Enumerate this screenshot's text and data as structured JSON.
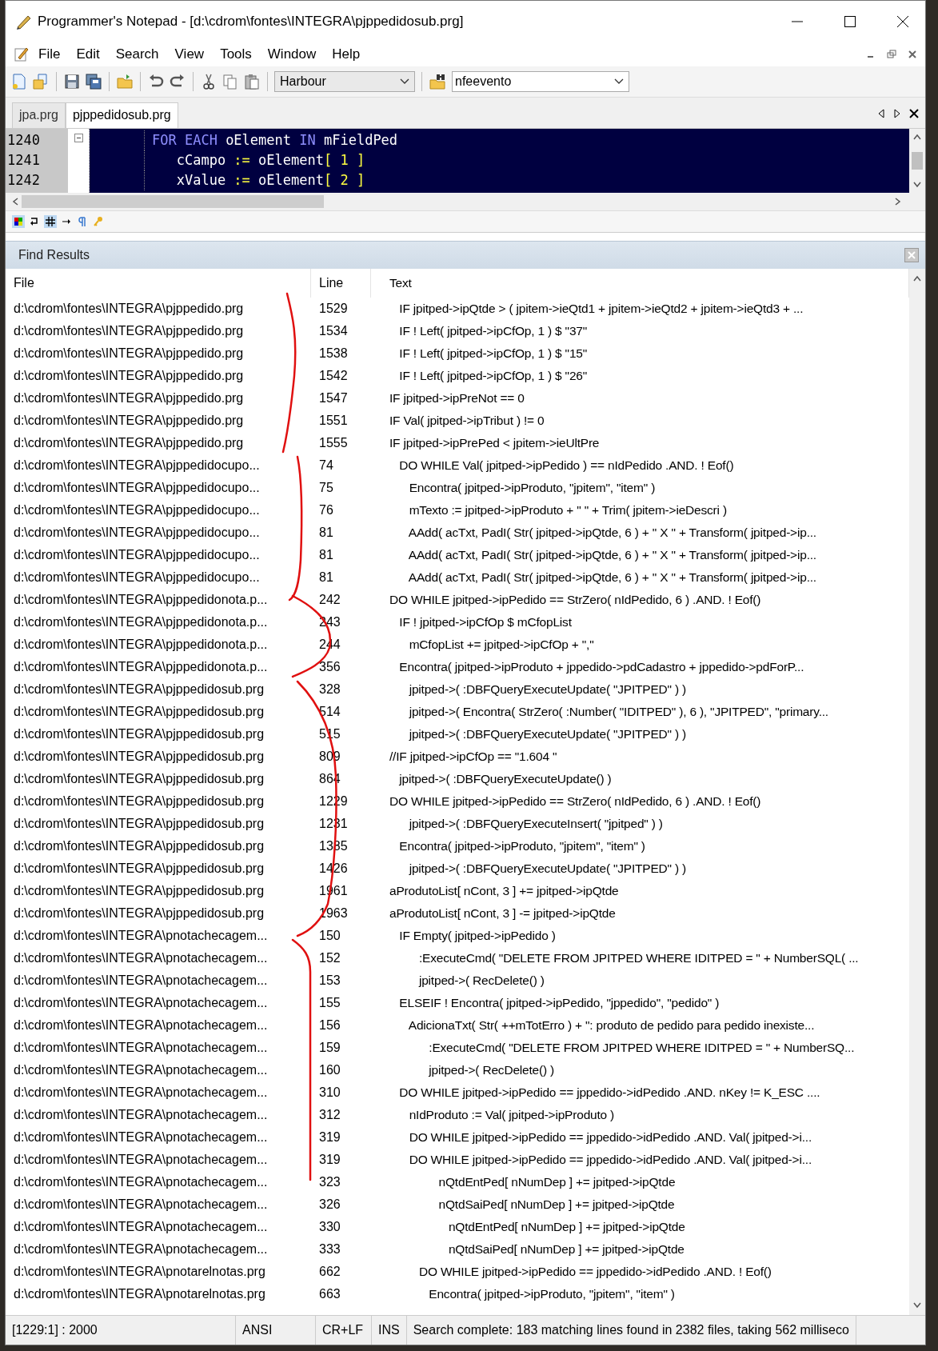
{
  "window": {
    "title": "Programmer's Notepad - [d:\\cdrom\\fontes\\INTEGRA\\pjppedidosub.prg]"
  },
  "menu": [
    "File",
    "Edit",
    "Search",
    "View",
    "Tools",
    "Window",
    "Help"
  ],
  "toolbar": {
    "language": "Harbour",
    "find": "nfeevento"
  },
  "tabs": [
    {
      "label": "jpa.prg",
      "selected": false
    },
    {
      "label": "pjppedidosub.prg",
      "selected": true
    }
  ],
  "editor": {
    "lines": [
      {
        "number": "1240",
        "tokens": [
          {
            "text": "FOR EACH",
            "kind": "keyword"
          },
          {
            "text": " oElement ",
            "kind": "ident"
          },
          {
            "text": "IN",
            "kind": "keyword"
          },
          {
            "text": " mFieldPed",
            "kind": "ident"
          }
        ]
      },
      {
        "number": "1241",
        "tokens": [
          {
            "text": "   cCampo ",
            "kind": "ident"
          },
          {
            "text": ":=",
            "kind": "op"
          },
          {
            "text": " oElement",
            "kind": "ident"
          },
          {
            "text": "[ 1 ]",
            "kind": "op"
          }
        ]
      },
      {
        "number": "1242",
        "tokens": [
          {
            "text": "   xValue ",
            "kind": "ident"
          },
          {
            "text": ":=",
            "kind": "op"
          },
          {
            "text": " oElement",
            "kind": "ident"
          },
          {
            "text": "[ 2 ]",
            "kind": "op"
          }
        ]
      }
    ]
  },
  "find_results": {
    "title": "Find Results",
    "columns": [
      "File",
      "Line",
      "Text"
    ],
    "rows": [
      {
        "file": "d:\\cdrom\\fontes\\INTEGRA\\pjppedido.prg",
        "line": "1529",
        "text": "   IF jpitped->ipQtde > ( jpitem->ieQtd1 + jpitem->ieQtd2 + jpitem->ieQtd3 + ..."
      },
      {
        "file": "d:\\cdrom\\fontes\\INTEGRA\\pjppedido.prg",
        "line": "1534",
        "text": "   IF ! Left( jpitped->ipCfOp, 1 ) $ \"37\""
      },
      {
        "file": "d:\\cdrom\\fontes\\INTEGRA\\pjppedido.prg",
        "line": "1538",
        "text": "   IF ! Left( jpitped->ipCfOp, 1 ) $ \"15\""
      },
      {
        "file": "d:\\cdrom\\fontes\\INTEGRA\\pjppedido.prg",
        "line": "1542",
        "text": "   IF ! Left( jpitped->ipCfOp, 1 ) $ \"26\""
      },
      {
        "file": "d:\\cdrom\\fontes\\INTEGRA\\pjppedido.prg",
        "line": "1547",
        "text": "IF jpitped->ipPreNot == 0"
      },
      {
        "file": "d:\\cdrom\\fontes\\INTEGRA\\pjppedido.prg",
        "line": "1551",
        "text": "IF Val( jpitped->ipTribut ) != 0"
      },
      {
        "file": "d:\\cdrom\\fontes\\INTEGRA\\pjppedido.prg",
        "line": "1555",
        "text": "IF jpitped->ipPrePed < jpitem->ieUltPre"
      },
      {
        "file": "d:\\cdrom\\fontes\\INTEGRA\\pjppedidocupo...",
        "line": "74",
        "text": "   DO WHILE Val( jpitped->ipPedido ) == nIdPedido .AND. ! Eof()"
      },
      {
        "file": "d:\\cdrom\\fontes\\INTEGRA\\pjppedidocupo...",
        "line": "75",
        "text": "      Encontra( jpitped->ipProduto, \"jpitem\", \"item\" )"
      },
      {
        "file": "d:\\cdrom\\fontes\\INTEGRA\\pjppedidocupo...",
        "line": "76",
        "text": "      mTexto := jpitped->ipProduto + \" \" + Trim( jpitem->ieDescri )"
      },
      {
        "file": "d:\\cdrom\\fontes\\INTEGRA\\pjppedidocupo...",
        "line": "81",
        "text": "      AAdd( acTxt, PadI( Str( jpitped->ipQtde, 6 ) + \" X \" + Transform( jpitped->ip..."
      },
      {
        "file": "d:\\cdrom\\fontes\\INTEGRA\\pjppedidocupo...",
        "line": "81",
        "text": "      AAdd( acTxt, PadI( Str( jpitped->ipQtde, 6 ) + \" X \" + Transform( jpitped->ip..."
      },
      {
        "file": "d:\\cdrom\\fontes\\INTEGRA\\pjppedidocupo...",
        "line": "81",
        "text": "      AAdd( acTxt, PadI( Str( jpitped->ipQtde, 6 ) + \" X \" + Transform( jpitped->ip..."
      },
      {
        "file": "d:\\cdrom\\fontes\\INTEGRA\\pjppedidonota.p...",
        "line": "242",
        "text": "DO WHILE jpitped->ipPedido == StrZero( nIdPedido, 6 ) .AND. ! Eof()"
      },
      {
        "file": "d:\\cdrom\\fontes\\INTEGRA\\pjppedidonota.p...",
        "line": "243",
        "text": "   IF ! jpitped->ipCfOp $ mCfopList"
      },
      {
        "file": "d:\\cdrom\\fontes\\INTEGRA\\pjppedidonota.p...",
        "line": "244",
        "text": "      mCfopList += jpitped->ipCfOp + \",\""
      },
      {
        "file": "d:\\cdrom\\fontes\\INTEGRA\\pjppedidonota.p...",
        "line": "356",
        "text": "   Encontra( jpitped->ipProduto + jppedido->pdCadastro + jppedido->pdForP..."
      },
      {
        "file": "d:\\cdrom\\fontes\\INTEGRA\\pjppedidosub.prg",
        "line": "328",
        "text": "      jpitped->( :DBFQueryExecuteUpdate( \"JPITPED\" ) )"
      },
      {
        "file": "d:\\cdrom\\fontes\\INTEGRA\\pjppedidosub.prg",
        "line": "514",
        "text": "      jpitped->( Encontra( StrZero( :Number( \"IDITPED\" ), 6 ), \"JPITPED\", \"primary..."
      },
      {
        "file": "d:\\cdrom\\fontes\\INTEGRA\\pjppedidosub.prg",
        "line": "515",
        "text": "      jpitped->( :DBFQueryExecuteUpdate( \"JPITPED\" ) )"
      },
      {
        "file": "d:\\cdrom\\fontes\\INTEGRA\\pjppedidosub.prg",
        "line": "809",
        "text": "//IF jpitped->ipCfOp == \"1.604 \""
      },
      {
        "file": "d:\\cdrom\\fontes\\INTEGRA\\pjppedidosub.prg",
        "line": "864",
        "text": "   jpitped->( :DBFQueryExecuteUpdate() )"
      },
      {
        "file": "d:\\cdrom\\fontes\\INTEGRA\\pjppedidosub.prg",
        "line": "1229",
        "text": "DO WHILE jpitped->ipPedido == StrZero( nIdPedido, 6 ) .AND. ! Eof()"
      },
      {
        "file": "d:\\cdrom\\fontes\\INTEGRA\\pjppedidosub.prg",
        "line": "1231",
        "text": "      jpitped->( :DBFQueryExecuteInsert( \"jpitped\" ) )"
      },
      {
        "file": "d:\\cdrom\\fontes\\INTEGRA\\pjppedidosub.prg",
        "line": "1385",
        "text": "   Encontra( jpitped->ipProduto, \"jpitem\", \"item\" )"
      },
      {
        "file": "d:\\cdrom\\fontes\\INTEGRA\\pjppedidosub.prg",
        "line": "1426",
        "text": "      jpitped->( :DBFQueryExecuteUpdate( \"JPITPED\" ) )"
      },
      {
        "file": "d:\\cdrom\\fontes\\INTEGRA\\pjppedidosub.prg",
        "line": "1961",
        "text": "aProdutoList[ nCont, 3 ] += jpitped->ipQtde"
      },
      {
        "file": "d:\\cdrom\\fontes\\INTEGRA\\pjppedidosub.prg",
        "line": "1963",
        "text": "aProdutoList[ nCont, 3 ] -= jpitped->ipQtde"
      },
      {
        "file": "d:\\cdrom\\fontes\\INTEGRA\\pnotachecagem...",
        "line": "150",
        "text": "   IF Empty( jpitped->ipPedido )"
      },
      {
        "file": "d:\\cdrom\\fontes\\INTEGRA\\pnotachecagem...",
        "line": "152",
        "text": "         :ExecuteCmd( \"DELETE FROM JPITPED WHERE IDITPED = \" + NumberSQL( ..."
      },
      {
        "file": "d:\\cdrom\\fontes\\INTEGRA\\pnotachecagem...",
        "line": "153",
        "text": "         jpitped->( RecDelete() )"
      },
      {
        "file": "d:\\cdrom\\fontes\\INTEGRA\\pnotachecagem...",
        "line": "155",
        "text": "   ELSEIF ! Encontra( jpitped->ipPedido, \"jppedido\", \"pedido\" )"
      },
      {
        "file": "d:\\cdrom\\fontes\\INTEGRA\\pnotachecagem...",
        "line": "156",
        "text": "      AdicionaTxt( Str( ++mTotErro ) + \": produto de pedido para pedido inexiste..."
      },
      {
        "file": "d:\\cdrom\\fontes\\INTEGRA\\pnotachecagem...",
        "line": "159",
        "text": "            :ExecuteCmd( \"DELETE FROM JPITPED WHERE IDITPED = \" + NumberSQ..."
      },
      {
        "file": "d:\\cdrom\\fontes\\INTEGRA\\pnotachecagem...",
        "line": "160",
        "text": "            jpitped->( RecDelete() )"
      },
      {
        "file": "d:\\cdrom\\fontes\\INTEGRA\\pnotachecagem...",
        "line": "310",
        "text": "   DO WHILE jpitped->ipPedido == jppedido->idPedido .AND. nKey != K_ESC ...."
      },
      {
        "file": "d:\\cdrom\\fontes\\INTEGRA\\pnotachecagem...",
        "line": "312",
        "text": "      nIdProduto := Val( jpitped->ipProduto )"
      },
      {
        "file": "d:\\cdrom\\fontes\\INTEGRA\\pnotachecagem...",
        "line": "319",
        "text": "      DO WHILE jpitped->ipPedido == jppedido->idPedido .AND. Val( jpitped->i..."
      },
      {
        "file": "d:\\cdrom\\fontes\\INTEGRA\\pnotachecagem...",
        "line": "319",
        "text": "      DO WHILE jpitped->ipPedido == jppedido->idPedido .AND. Val( jpitped->i..."
      },
      {
        "file": "d:\\cdrom\\fontes\\INTEGRA\\pnotachecagem...",
        "line": "323",
        "text": "               nQtdEntPed[ nNumDep ] += jpitped->ipQtde"
      },
      {
        "file": "d:\\cdrom\\fontes\\INTEGRA\\pnotachecagem...",
        "line": "326",
        "text": "               nQtdSaiPed[ nNumDep ] += jpitped->ipQtde"
      },
      {
        "file": "d:\\cdrom\\fontes\\INTEGRA\\pnotachecagem...",
        "line": "330",
        "text": "                  nQtdEntPed[ nNumDep ] += jpitped->ipQtde"
      },
      {
        "file": "d:\\cdrom\\fontes\\INTEGRA\\pnotachecagem...",
        "line": "333",
        "text": "                  nQtdSaiPed[ nNumDep ] += jpitped->ipQtde"
      },
      {
        "file": "d:\\cdrom\\fontes\\INTEGRA\\pnotarelnotas.prg",
        "line": "662",
        "text": "         DO WHILE jpitped->ipPedido == jppedido->idPedido .AND. ! Eof()"
      },
      {
        "file": "d:\\cdrom\\fontes\\INTEGRA\\pnotarelnotas.prg",
        "line": "663",
        "text": "            Encontra( jpitped->ipProduto, \"jpitem\", \"item\" )"
      }
    ]
  },
  "status_bar": [
    "[1229:1] : 2000",
    "ANSI",
    "CR+LF",
    "INS",
    "Search complete: 183 matching lines found in 2382 files, taking 562 milliseco"
  ]
}
